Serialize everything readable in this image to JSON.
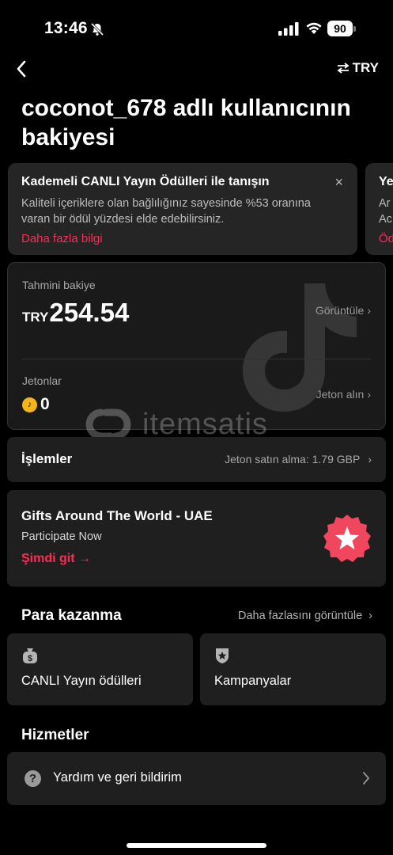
{
  "status_bar": {
    "time": "13:46",
    "battery": "90",
    "icons": [
      "bell-off-icon",
      "signal-icon",
      "wifi-icon",
      "battery-icon"
    ]
  },
  "nav": {
    "back_icon": "chevron-left-icon",
    "currency_icon": "swap-arrows-icon",
    "currency": "TRY"
  },
  "title": "coconot_678 adlı kullanıcının bakiyesi",
  "promo": {
    "title": "Kademeli CANLI Yayın Ödülleri ile tanışın",
    "text": "Kaliteli içeriklere olan bağlılığınız sayesinde %53 oranına varan bir ödül yüzdesi elde edebilirsiniz.",
    "link": "Daha fazla bilgi",
    "close": "×",
    "next_title": "Ye",
    "next_text_1": "Ar",
    "next_text_2": "Ac",
    "next_link": "Öd"
  },
  "balance": {
    "label": "Tahmini bakiye",
    "currency": "TRY",
    "value": "254.54",
    "view": "Görüntüle",
    "coins_label": "Jetonlar",
    "coins_value": "0",
    "coins_action": "Jeton alın"
  },
  "watermark": {
    "text": "itemsatis"
  },
  "transactions": {
    "label": "İşlemler",
    "value": "Jeton satın alma: 1.79 GBP"
  },
  "event": {
    "title": "Gifts Around The World - UAE",
    "subtitle": "Participate Now",
    "link": "Şimdi git →",
    "badge_icon": "star-badge-icon"
  },
  "earn": {
    "title": "Para kazanma",
    "more": "Daha fazlasını görüntüle",
    "cards": [
      {
        "label": "CANLI Yayın ödülleri",
        "icon": "money-bag-icon"
      },
      {
        "label": "Kampanyalar",
        "icon": "shield-star-icon"
      }
    ]
  },
  "services": {
    "title": "Hizmetler",
    "help": "Yardım ve geri bildirim"
  },
  "colors": {
    "accent": "#fe2c55",
    "background": "#000000",
    "card": "#1f1f1f",
    "coin": "#f2b51c"
  }
}
